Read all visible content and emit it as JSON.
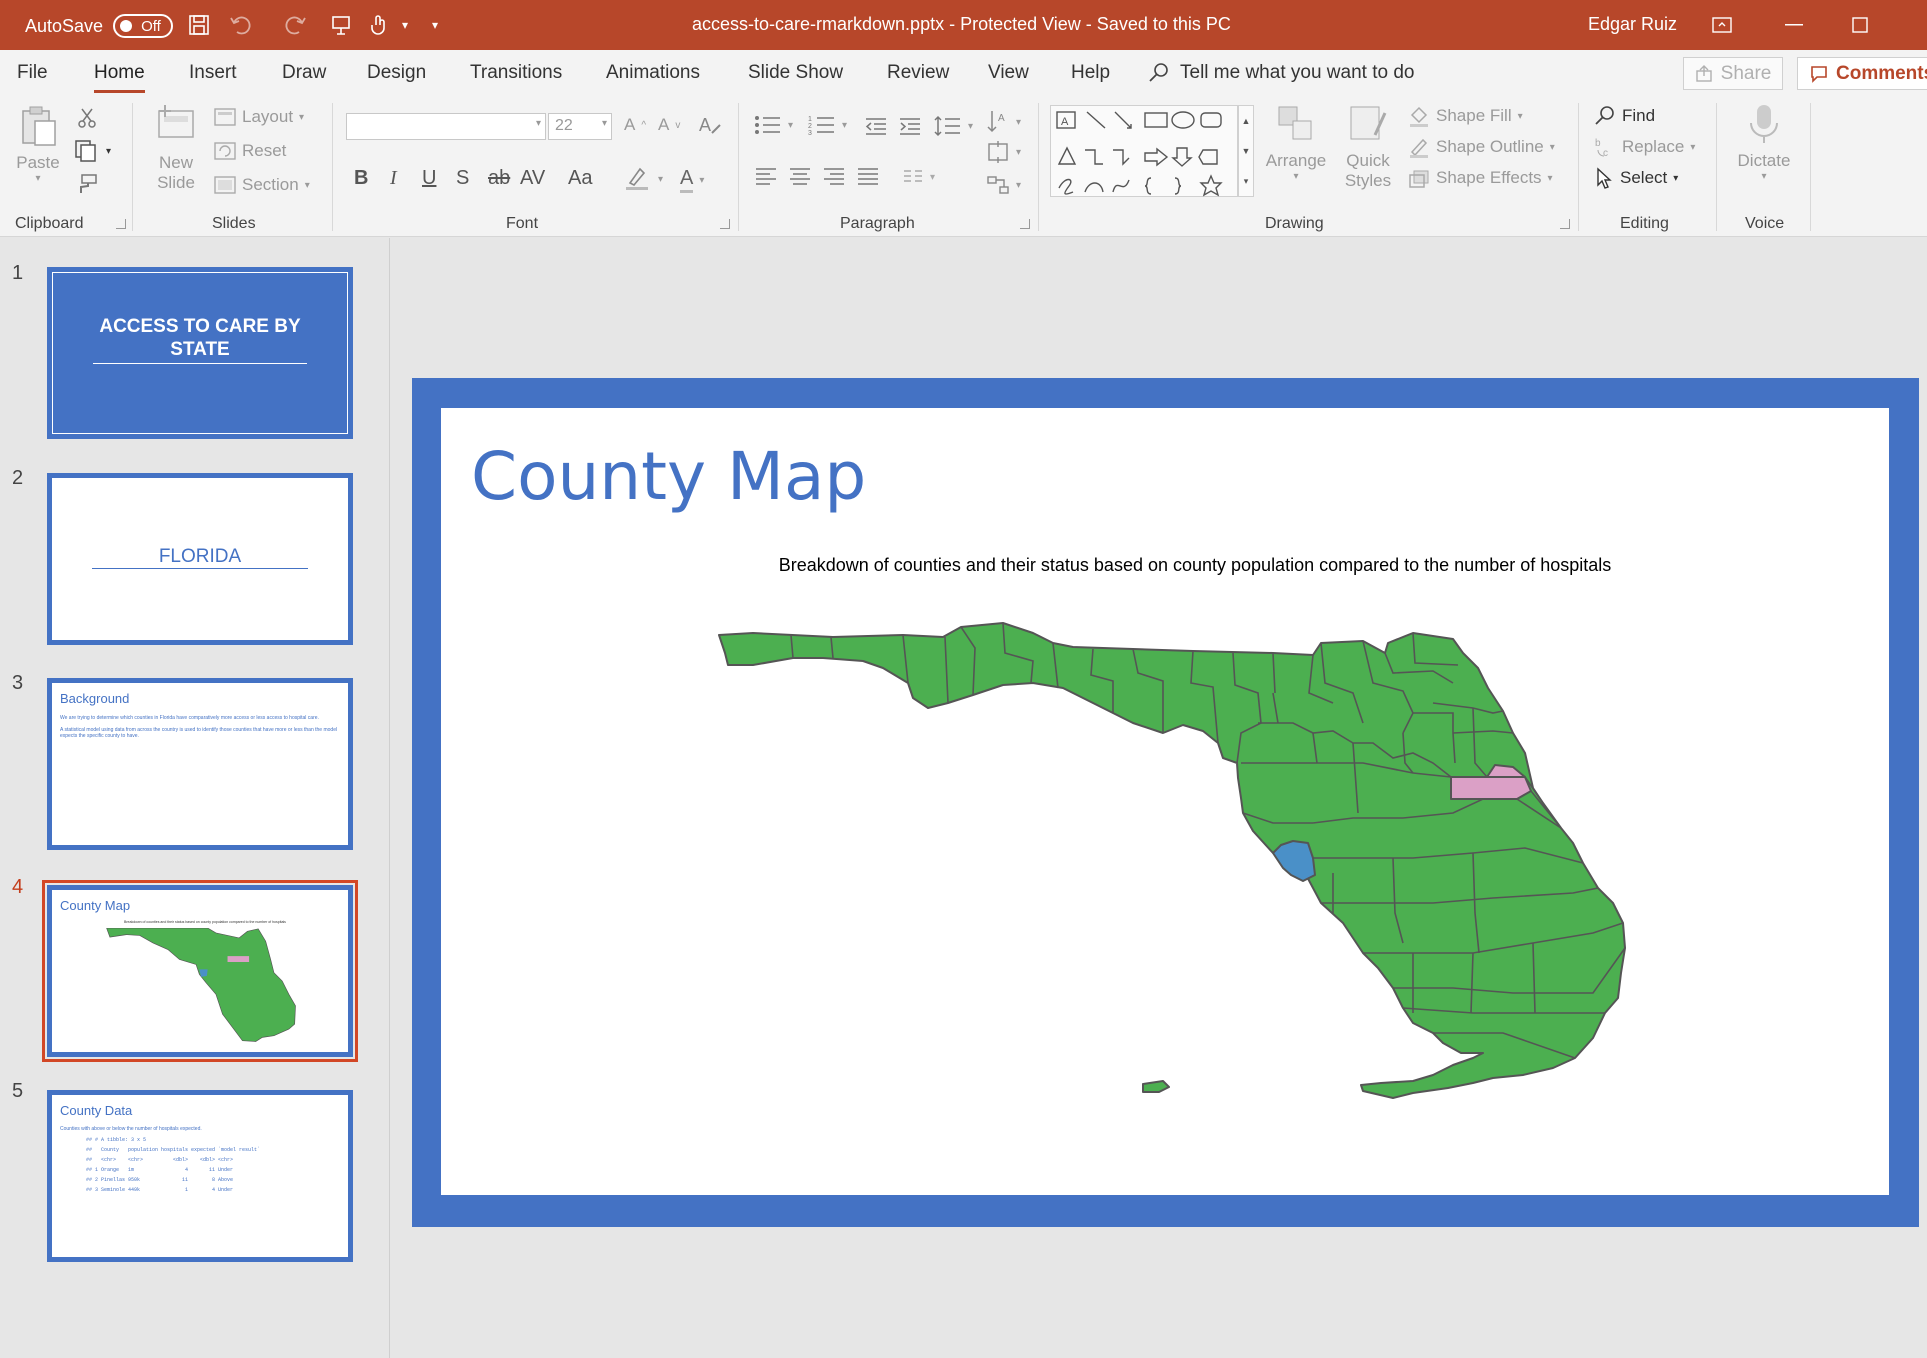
{
  "titlebar": {
    "autosave_label": "AutoSave",
    "autosave_state": "Off",
    "document_title": "access-to-care-rmarkdown.pptx  -  Protected View  -  Saved to this PC",
    "user_name": "Edgar Ruiz"
  },
  "tabs": [
    "File",
    "Home",
    "Insert",
    "Draw",
    "Design",
    "Transitions",
    "Animations",
    "Slide Show",
    "Review",
    "View",
    "Help"
  ],
  "active_tab": "Home",
  "tell_me": "Tell me what you want to do",
  "share_label": "Share",
  "comments_label": "Comments",
  "ribbon": {
    "clipboard": {
      "paste": "Paste",
      "group": "Clipboard"
    },
    "slides": {
      "new_slide_1": "New",
      "new_slide_2": "Slide",
      "layout": "Layout",
      "reset": "Reset",
      "section": "Section",
      "group": "Slides"
    },
    "font": {
      "font_size": "22",
      "group": "Font",
      "bold": "B",
      "italic": "I",
      "underline": "U",
      "shadow": "S",
      "strike": "ab",
      "spacing": "AV",
      "case": "Aa",
      "color": "A"
    },
    "paragraph": {
      "group": "Paragraph"
    },
    "drawing": {
      "arrange": "Arrange",
      "quick_styles_1": "Quick",
      "quick_styles_2": "Styles",
      "shape_fill": "Shape Fill",
      "shape_outline": "Shape Outline",
      "shape_effects": "Shape Effects",
      "group": "Drawing"
    },
    "editing": {
      "find": "Find",
      "replace": "Replace",
      "select": "Select",
      "group": "Editing"
    },
    "voice": {
      "dictate": "Dictate",
      "group": "Voice"
    }
  },
  "thumbnails": [
    {
      "number": "1",
      "title": "ACCESS TO CARE BY STATE"
    },
    {
      "number": "2",
      "title": "FLORIDA"
    },
    {
      "number": "3",
      "title": "Background",
      "line1": "We are trying to determine which counties in Florida have comparatively more access or less access to hospital care.",
      "line2": "A statistical model using data from across the country is used to identify those counties that have more or less than the model expects the specific county to have."
    },
    {
      "number": "4",
      "title": "County Map",
      "subtitle": "Breakdown of counties and their status based on county population compared to the number of hospitals"
    },
    {
      "number": "5",
      "title": "County Data",
      "subtitle": "Counties with above or below the number of hospitals expected.",
      "code": [
        "## # A tibble: 3 x 5",
        "##   County   population hospitals expected `model result`",
        "##   <chr>    <chr>          <dbl>    <dbl> <chr>",
        "## 1 Orange   1m                 4       11 Under",
        "## 2 Pinellas 950k              11        8 Above",
        "## 3 Seminole 449k               1        4 Under"
      ]
    }
  ],
  "active_slide": "4",
  "slide": {
    "title": "County Map",
    "subtitle": "Breakdown of counties and their status based on county population compared to the number of hospitals"
  },
  "map": {
    "colors": {
      "default": "#4caf50",
      "above": "#4a90c8",
      "under": "#dba0c6",
      "border": "#555555"
    }
  }
}
